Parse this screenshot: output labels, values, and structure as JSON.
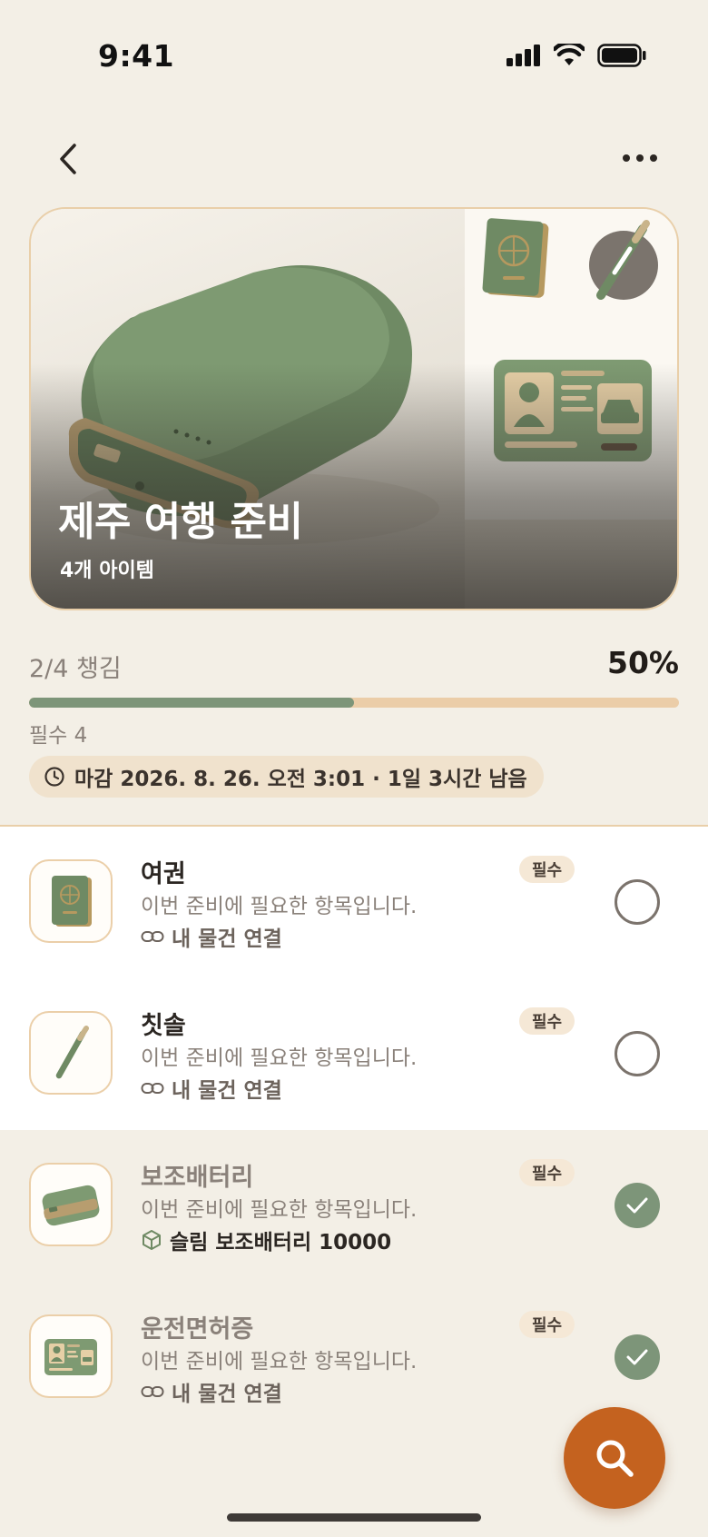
{
  "status_bar": {
    "time": "9:41"
  },
  "header": {
    "back_icon": "chevron-left-icon",
    "more_icon": "ellipsis-icon"
  },
  "hero": {
    "title": "제주 여행 준비",
    "subtitle": "4개 아이템"
  },
  "progress": {
    "label": "2/4 챙김",
    "percent_label": "50%",
    "fraction": 0.5,
    "required": "필수 4",
    "deadline": "마감 2026. 8. 26. 오전 3:01 · 1일 3시간 남음"
  },
  "items": [
    {
      "name": "여권",
      "desc": "이번 준비에 필요한 항목입니다.",
      "badge": "필수",
      "link": "내 물건 연결",
      "checked": false,
      "thumb": "passport"
    },
    {
      "name": "칫솔",
      "desc": "이번 준비에 필요한 항목입니다.",
      "badge": "필수",
      "link": "내 물건 연결",
      "checked": false,
      "thumb": "toothbrush"
    },
    {
      "name": "보조배터리",
      "desc": "이번 준비에 필요한 항목입니다.",
      "badge": "필수",
      "link": "슬림 보조배터리 10000",
      "checked": true,
      "thumb": "power-bank"
    },
    {
      "name": "운전면허증",
      "desc": "이번 준비에 필요한 항목입니다.",
      "badge": "필수",
      "link": "내 물건 연결",
      "checked": true,
      "thumb": "driver-license"
    }
  ],
  "colors": {
    "accent": "#c4621f",
    "green": "#7d9579",
    "beige": "#ebcda8",
    "background": "#f3efe6"
  },
  "fab": {
    "icon": "search-icon"
  }
}
